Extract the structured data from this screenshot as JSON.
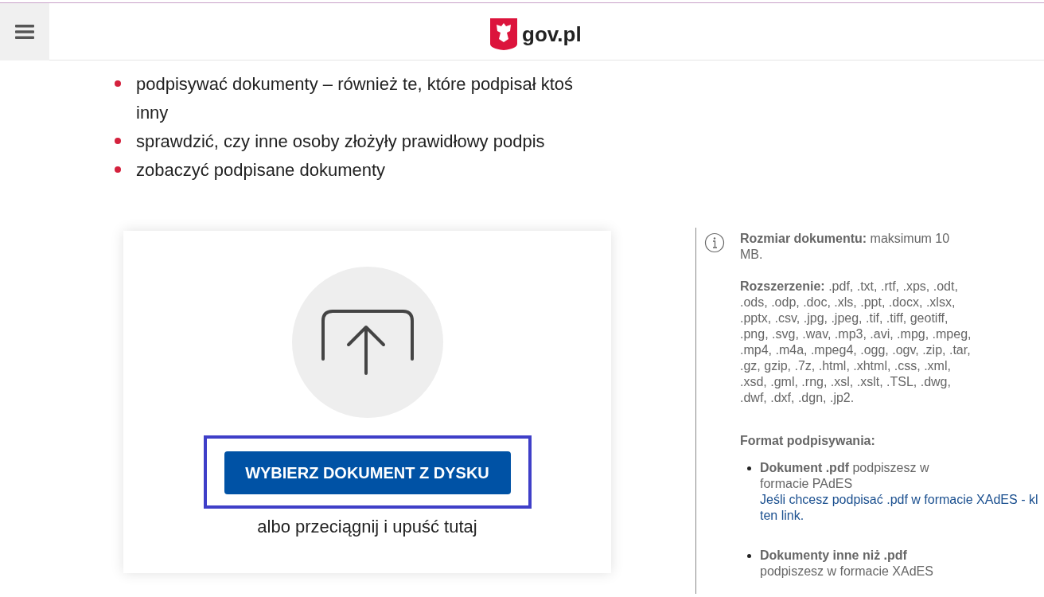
{
  "header": {
    "logo_text": "gov.pl"
  },
  "features": [
    "podpisywać dokumenty – również te, które podpisał ktoś inny",
    "sprawdzić, czy inne osoby złożyły prawidłowy podpis",
    "zobaczyć podpisane dokumenty"
  ],
  "upload": {
    "button": "WYBIERZ DOKUMENT Z DYSKU",
    "focused": true,
    "hint": "albo przeciągnij i upuść tutaj"
  },
  "info": {
    "size": "**Rozmiar dokumentu:** maksimum 10 MB.",
    "extensions": "**Rozszerzenie:** .pdf, .txt, .rtf, .xps, .odt, .ods, .odp, .doc, .xls, .ppt, .docx, .xlsx, .pptx, .csv, .jpg, .jpeg, .tif, .tiff, geotiff, .png, .svg, .wav, .mp3, .avi, .mpg, .mpeg, .mp4, .m4a, .mpeg4, .ogg, .ogv, .zip, .tar, .gz, gzip, .7z, .html, .xhtml, .css, .xml, .xsd, .gml, .rng, .xsl, .xslt, .TSL, .dwg, .dwf, .dxf, .dgn, .jp2.",
    "format_heading": "Format podpisywania:",
    "formats": [
      {
        "text": "**Dokument .pdf** podpiszesz w formacie PAdES",
        "link_lines": [
          "Jeśli chcesz podpisać .pdf w formacie XAdES - kl",
          "ten link."
        ]
      },
      {
        "text": "**Dokumenty inne niż .pdf** podpiszesz w formacie XAdES"
      }
    ]
  }
}
